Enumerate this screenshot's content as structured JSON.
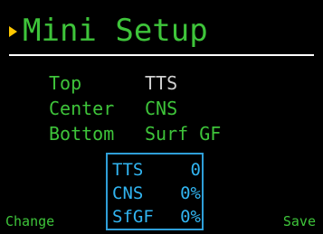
{
  "header": {
    "title": "Mini Setup",
    "cursor_icon": "triangle-right-icon",
    "cursor_color": "#ffc800",
    "text_color": "#3ec43a"
  },
  "settings": [
    {
      "label": "Top",
      "value": "TTS",
      "selected": true
    },
    {
      "label": "Center",
      "value": "CNS",
      "selected": false
    },
    {
      "label": "Bottom",
      "value": "Surf GF",
      "selected": false
    }
  ],
  "preview": {
    "border_color": "#2f9fd8",
    "rows": [
      {
        "label": "TTS",
        "value": "0"
      },
      {
        "label": "CNS",
        "value": "0%"
      },
      {
        "label": "SfGF",
        "value": "0%"
      }
    ]
  },
  "softkeys": {
    "left": "Change",
    "right": "Save"
  }
}
